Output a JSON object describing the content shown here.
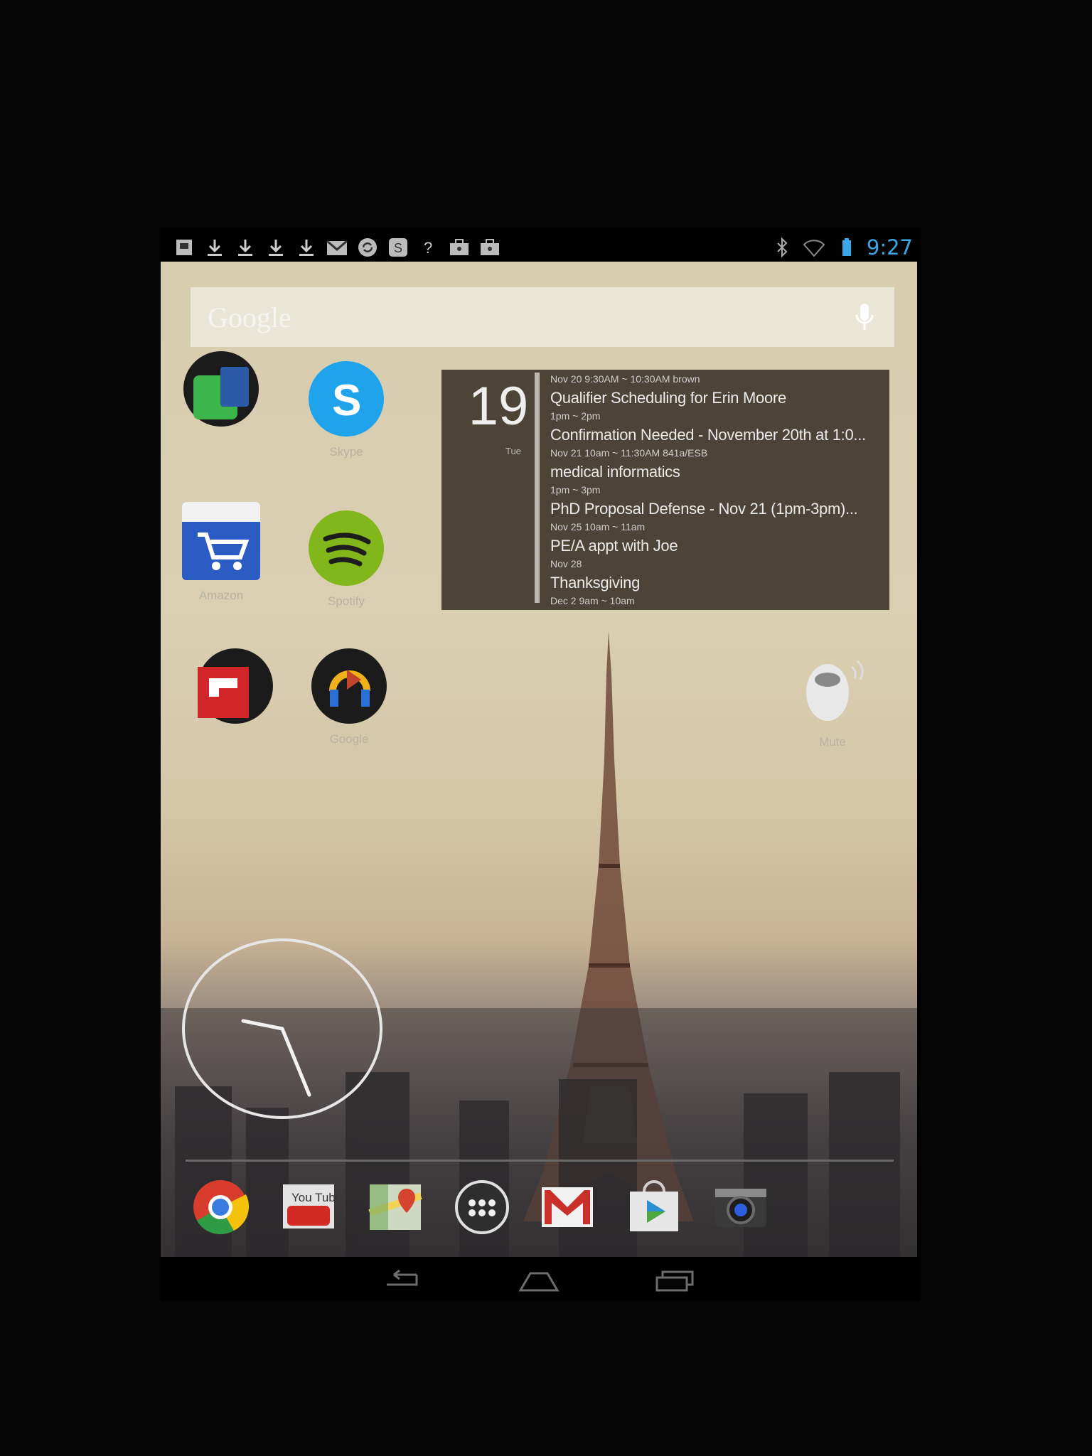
{
  "status_bar": {
    "notification_icons": [
      "storage-icon",
      "download-icon",
      "download-icon",
      "download-icon",
      "download-icon",
      "gmail-icon",
      "sync-icon",
      "skype-icon",
      "help-icon",
      "briefcase-icon",
      "briefcase-icon"
    ],
    "time": "9:27",
    "time_color": "#3aa7e8"
  },
  "search": {
    "logo_text": "Google"
  },
  "apps": [
    {
      "label": "",
      "icon": "evernote-folder-icon"
    },
    {
      "label": "Skype",
      "icon": "skype-icon"
    },
    {
      "label": "Amazon",
      "icon": "amazon-icon"
    },
    {
      "label": "Spotify",
      "icon": "spotify-icon"
    },
    {
      "label": "",
      "icon": "flipboard-folder-icon"
    },
    {
      "label": "Google",
      "icon": "google-folder-icon"
    },
    {
      "label": "Mute",
      "icon": "mute-icon"
    }
  ],
  "calendar": {
    "day": "19",
    "weekday": "Tue",
    "events": [
      {
        "meta": "Nov 20   9:30AM ~ 10:30AM   brown",
        "title": "Qualifier Scheduling for Erin Moore"
      },
      {
        "meta": "1pm ~ 2pm",
        "title": "Confirmation Needed - November 20th at 1:0..."
      },
      {
        "meta": "Nov 21   10am ~ 11:30AM   841a/ESB",
        "title": "medical informatics"
      },
      {
        "meta": "1pm ~ 3pm",
        "title": "PhD Proposal Defense - Nov 21 (1pm-3pm)..."
      },
      {
        "meta": "Nov 25   10am ~ 11am",
        "title": "PE/A appt with Joe"
      },
      {
        "meta": "Nov 28",
        "title": "Thanksgiving"
      },
      {
        "meta": "Dec 2   9am ~ 10am",
        "title": ""
      }
    ]
  },
  "dock": [
    "chrome-icon",
    "youtube-icon",
    "maps-icon",
    "app-drawer-icon",
    "gmail-icon",
    "play-store-icon",
    "camera-icon"
  ],
  "dock_labels": {
    "youtube": "You Tube"
  },
  "nav": [
    "back-icon",
    "home-icon",
    "recent-apps-icon"
  ]
}
